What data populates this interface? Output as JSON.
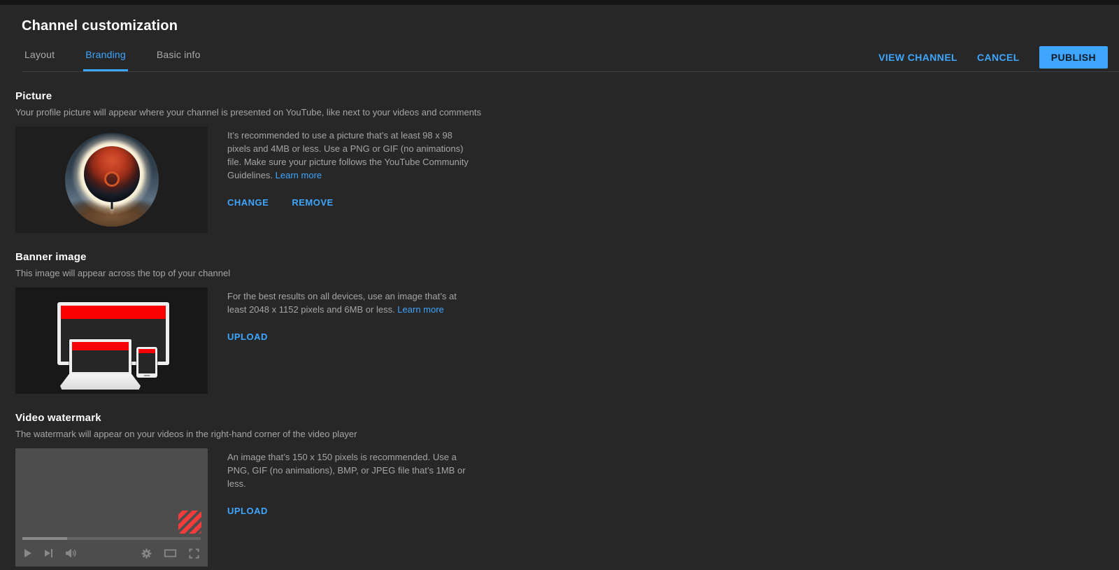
{
  "header": {
    "title": "Channel customization",
    "tabs": [
      {
        "label": "Layout",
        "active": false
      },
      {
        "label": "Branding",
        "active": true
      },
      {
        "label": "Basic info",
        "active": false
      }
    ],
    "actions": {
      "view_channel": "VIEW CHANNEL",
      "cancel": "CANCEL",
      "publish": "PUBLISH"
    }
  },
  "sections": {
    "picture": {
      "heading": "Picture",
      "description": "Your profile picture will appear where your channel is presented on YouTube, like next to your videos and comments",
      "info": "It’s recommended to use a picture that’s at least 98 x 98 pixels and 4MB or less. Use a PNG or GIF (no animations) file. Make sure your picture follows the YouTube Community Guidelines. ",
      "learn_more": "Learn more",
      "change_label": "CHANGE",
      "remove_label": "REMOVE"
    },
    "banner": {
      "heading": "Banner image",
      "description": "This image will appear across the top of your channel",
      "info": "For the best results on all devices, use an image that’s at least 2048 x 1152 pixels and 6MB or less. ",
      "learn_more": "Learn more",
      "upload_label": "UPLOAD"
    },
    "watermark": {
      "heading": "Video watermark",
      "description": "The watermark will appear on your videos in the right-hand corner of the video player",
      "info": "An image that’s 150 x 150 pixels is recommended. Use a PNG, GIF (no animations), BMP, or JPEG file that’s 1MB or less.",
      "upload_label": "UPLOAD"
    }
  },
  "player": {
    "progress_percent": 25,
    "icons": [
      "play-icon",
      "next-icon",
      "volume-icon",
      "settings-icon",
      "theater-icon",
      "fullscreen-icon"
    ]
  },
  "colors": {
    "accent": "#3ea6ff",
    "page_background": "#272727",
    "preview_background": "#1e1e1e",
    "banner_red": "#fa0000",
    "watermark_red": "#f43b3b",
    "player_grey": "#4d4d4d"
  }
}
